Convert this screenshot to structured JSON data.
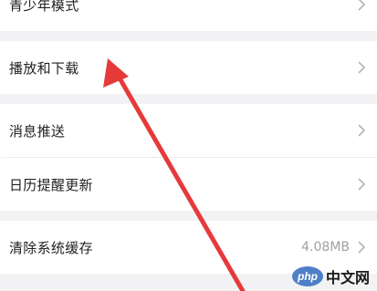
{
  "settings": {
    "items": [
      {
        "label": "青少年模式",
        "value": ""
      },
      {
        "label": "播放和下载",
        "value": ""
      },
      {
        "label": "消息推送",
        "value": ""
      },
      {
        "label": "日历提醒更新",
        "value": ""
      },
      {
        "label": "清除系统缓存",
        "value": "4.08MB"
      }
    ]
  },
  "watermark": {
    "badge": "php",
    "text": "中文网"
  },
  "colors": {
    "background": "#f2f2f4",
    "row": "#ffffff",
    "arrow": "#e63a3a",
    "chevron": "#b5b5b5",
    "watermark_badge": "#4f7fc8"
  },
  "icons": [
    "chevron-right-icon",
    "red-annotation-arrow"
  ]
}
